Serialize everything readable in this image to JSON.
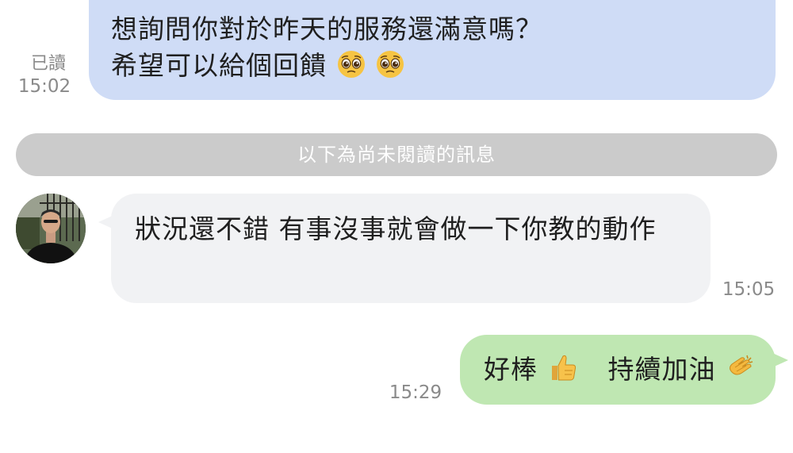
{
  "messages": [
    {
      "direction": "outgoing",
      "lines": [
        "想詢問你對於昨天的服務還滿意嗎？",
        "希望可以給個回饋"
      ],
      "emojis": [
        "pleading-face",
        "pleading-face"
      ],
      "read_label": "已讀",
      "time": "15:02"
    },
    {
      "direction": "incoming",
      "text": "狀況還不錯 有事沒事就會做一下你教的動作",
      "time": "15:05"
    },
    {
      "direction": "outgoing",
      "text_a": "好棒",
      "emoji_a": "thumbs-up",
      "text_b": "持續加油",
      "emoji_b": "clapping-hands",
      "time": "15:29"
    }
  ],
  "divider": {
    "label": "以下為尚未閱讀的訊息"
  },
  "colors": {
    "outgoing_top_bubble": "#cfdcf6",
    "incoming_bubble": "#f1f2f4",
    "outgoing_bubble": "#bfe7b2",
    "divider": "#cbcbcb",
    "meta_text": "#8a8a8a"
  }
}
